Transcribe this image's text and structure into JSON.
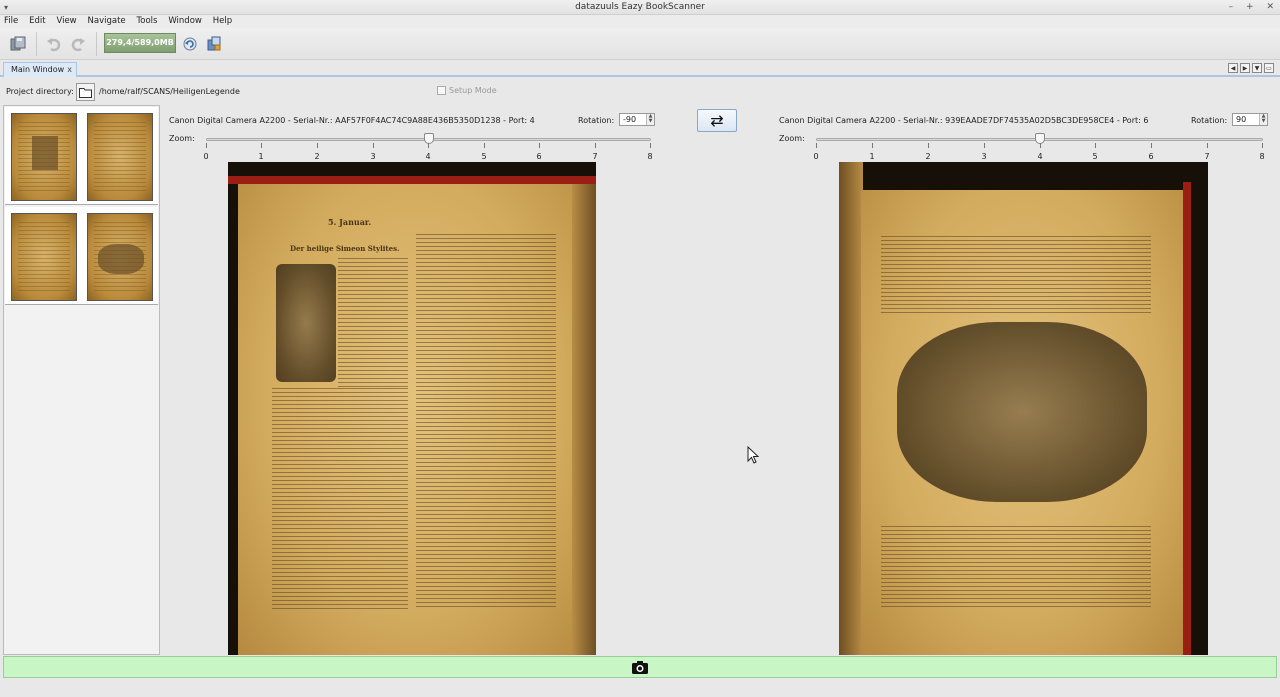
{
  "window": {
    "title": "datazuuls Eazy BookScanner",
    "menu_glyph": "▾",
    "controls": [
      "–",
      "+",
      "✕"
    ]
  },
  "menubar": {
    "items": [
      "File",
      "Edit",
      "View",
      "Navigate",
      "Tools",
      "Window",
      "Help"
    ]
  },
  "toolbar": {
    "memory_label": "279,4/589,0MB",
    "icons": [
      "save-icon",
      "undo-icon",
      "redo-icon",
      "memory-indicator",
      "refresh-icon",
      "export-icon"
    ]
  },
  "tabs": {
    "main_tab_label": "Main Window",
    "close_glyph": "x",
    "nav": [
      "◀",
      "▶",
      "▼",
      "▭"
    ]
  },
  "project": {
    "label": "Project directory:",
    "path": "/home/ralf/SCANS/HeiligenLegende",
    "setup_mode_label": "Setup Mode",
    "setup_mode_checked": false
  },
  "left_camera": {
    "label": "Canon Digital Camera A2200 - Serial-Nr.: AAF57F0F4AC74C9A88E436B5350D1238 - Port: 4",
    "rotation_label": "Rotation:",
    "rotation_value": "-90",
    "zoom_label": "Zoom:",
    "zoom_value": 4,
    "zoom_ticks": [
      "0",
      "1",
      "2",
      "3",
      "4",
      "5",
      "6",
      "7",
      "8"
    ],
    "page_header": "5. Januar.",
    "page_title": "Der heilige Simeon Stylites."
  },
  "right_camera": {
    "label": "Canon Digital Camera A2200 - Serial-Nr.: 939EAADE7DF74535A02D5BC3DE958CE4 - Port: 6",
    "rotation_label": "Rotation:",
    "rotation_value": "90",
    "zoom_label": "Zoom:",
    "zoom_value": 4,
    "zoom_ticks": [
      "0",
      "1",
      "2",
      "3",
      "4",
      "5",
      "6",
      "7",
      "8"
    ]
  },
  "swap_button_glyph": "⇄",
  "capture_button": "camera-icon",
  "colors": {
    "capture_bar": "#c8f7c5",
    "tab_accent": "#a9c6e6",
    "memory_bar": "#8fae80"
  }
}
